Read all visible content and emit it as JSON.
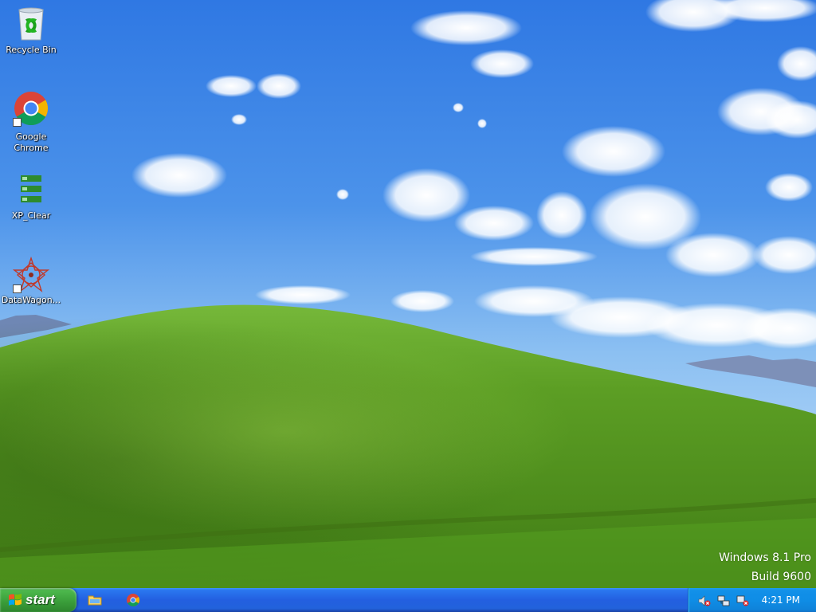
{
  "desktop": {
    "icons": [
      {
        "name": "recycle-bin",
        "label": "Recycle Bin"
      },
      {
        "name": "google-chrome",
        "label_line1": "Google",
        "label_line2": "Chrome"
      },
      {
        "name": "xp-clear",
        "label": "XP_Clear"
      },
      {
        "name": "datawagon",
        "label": "DataWagon..."
      }
    ],
    "watermark": {
      "line1": "Windows 8.1 Pro",
      "line2": "Build 9600"
    }
  },
  "taskbar": {
    "start_label": "start",
    "quick_launch": [
      "explorer-folder-icon",
      "chrome-icon"
    ],
    "tray_icons": [
      "volume-muted-icon",
      "network-icon",
      "network-error-icon"
    ],
    "clock": "4:21 PM"
  },
  "colors": {
    "taskbar_blue": "#235fe0",
    "tray_blue": "#0f8de6",
    "start_green": "#399c39",
    "sky": "#4a8fe8",
    "grass": "#5c9e2a"
  }
}
